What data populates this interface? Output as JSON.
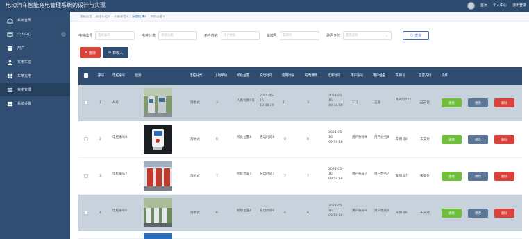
{
  "app": {
    "title": "电动汽车智能充电管理系统的设计与实现"
  },
  "topbar": {
    "home": "首页",
    "profile": "个人中心",
    "logout": "退出登录"
  },
  "sidebar": {
    "items": [
      {
        "label": "系统首页"
      },
      {
        "label": "个人中心"
      },
      {
        "label": "用户"
      },
      {
        "label": "充电车位"
      },
      {
        "label": "车辆充电"
      },
      {
        "label": "充电管理"
      },
      {
        "label": "系统设置"
      }
    ]
  },
  "tabs": [
    "系统首页",
    "充电车位×",
    "车辆充电×",
    "充电结算×",
    "领取设置×"
  ],
  "filters": {
    "num_label": "电桩编号",
    "num_placeholder": "电桩编号",
    "cat_label": "电桩分类",
    "cat_placeholder": "电桩分类",
    "user_label": "用户姓名",
    "user_placeholder": "用户姓名",
    "plate_label": "车牌号",
    "plate_placeholder": "车牌号",
    "paid_label": "是否支付",
    "paid_placeholder": "是否支付",
    "search_label": "查询"
  },
  "actions": {
    "delete_label": "删除",
    "log_label": "日收入"
  },
  "table": {
    "headers": [
      "序号",
      "电桩编号",
      "图片",
      "电桩分类",
      "小时单价",
      "所处位置",
      "充电时间",
      "使用时长",
      "充电费用",
      "结束时间",
      "用户账号",
      "用户姓名",
      "车牌号",
      "是否支付",
      "操作"
    ],
    "rows": [
      {
        "no": "1",
        "code": "A01",
        "cat": "落地式",
        "price": "3",
        "loc": "人民北路9号",
        "time": "2024-05-16 10:38:19",
        "dur": "1",
        "fee": "3",
        "end": "2024-05-16 10:38:36",
        "acct": "111",
        "name": "王磊",
        "plate": "粤A55555",
        "paid": "已支付"
      },
      {
        "no": "2",
        "code": "电桩编号8",
        "cat": "落地式",
        "price": "8",
        "loc": "所处位置8",
        "time": "充电时间8",
        "dur": "8",
        "fee": "8",
        "end": "2024-05-16 09:59:38",
        "acct": "用户账号8",
        "name": "用户姓名8",
        "plate": "车牌号8",
        "paid": "未支付"
      },
      {
        "no": "3",
        "code": "电桩编号7",
        "cat": "落地式",
        "price": "7",
        "loc": "所处位置7",
        "time": "充电时间7",
        "dur": "7",
        "fee": "7",
        "end": "2024-05-16 09:59:38",
        "acct": "用户账号7",
        "name": "用户姓名7",
        "plate": "车牌号7",
        "paid": "未支付"
      },
      {
        "no": "4",
        "code": "电桩编号6",
        "cat": "落地式",
        "price": "6",
        "loc": "所处位置6",
        "time": "充电时间6",
        "dur": "6",
        "fee": "6",
        "end": "2024-05-16 09:59:38",
        "acct": "用户账号6",
        "name": "用户姓名6",
        "plate": "车牌号6",
        "paid": "未支付"
      }
    ],
    "view_label": "查看",
    "edit_label": "修改",
    "del_label": "删除"
  },
  "colors": {
    "header": "#2e4c70",
    "sidebar": "#304e72",
    "view": "#6fbf3c",
    "edit": "#5b7696",
    "delete": "#d9433c"
  }
}
